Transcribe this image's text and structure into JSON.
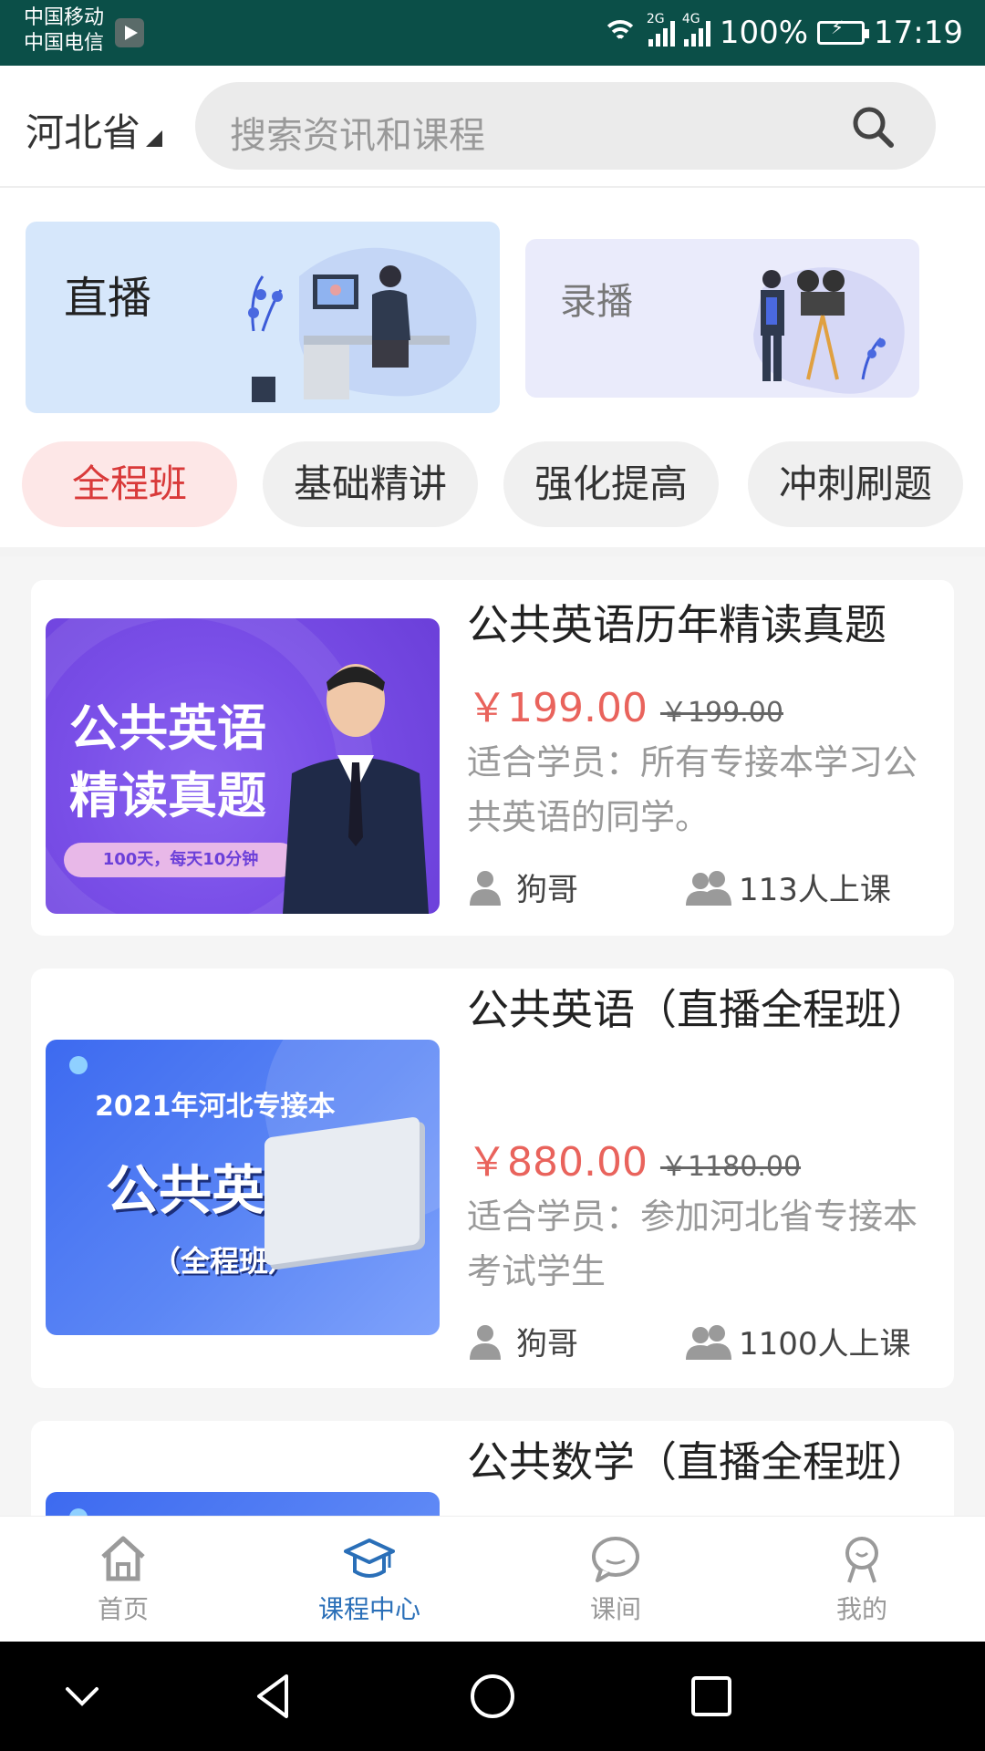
{
  "status_bar": {
    "carrier1": "中国移动",
    "carrier2": "中国电信",
    "net1": "2G",
    "net2": "4G",
    "battery": "100%",
    "time": "17:19"
  },
  "header": {
    "province": "河北省",
    "search_placeholder": "搜索资讯和课程"
  },
  "banners": {
    "live": "直播",
    "recorded": "录播"
  },
  "categories": [
    {
      "label": "全程班",
      "active": true
    },
    {
      "label": "基础精讲",
      "active": false
    },
    {
      "label": "强化提高",
      "active": false
    },
    {
      "label": "冲刺刷题",
      "active": false
    }
  ],
  "courses": [
    {
      "title": "公共英语历年精读真题",
      "price": "￥199.00",
      "old_price": "￥199.00",
      "desc": "适合学员：所有专接本学习公共英语的同学。",
      "teacher": "狗哥",
      "students": "113人上课",
      "thumb_line1": "公共英语",
      "thumb_line2": "精读真题",
      "thumb_badge": "100天，每天10分钟"
    },
    {
      "title": "公共英语（直播全程班）",
      "price": "￥880.00",
      "old_price": "￥1180.00",
      "desc": "适合学员：参加河北省专接本考试学生",
      "teacher": "狗哥",
      "students": "1100人上课",
      "thumb_line1": "2021年河北专接本",
      "thumb_line2": "公共英语",
      "thumb_line3": "（全程班）"
    },
    {
      "title": "公共数学（直播全程班）"
    }
  ],
  "bottom_nav": [
    {
      "label": "首页",
      "icon": "home-icon",
      "active": false
    },
    {
      "label": "课程中心",
      "icon": "graduation-cap-icon",
      "active": true
    },
    {
      "label": "课间",
      "icon": "chat-bubble-icon",
      "active": false
    },
    {
      "label": "我的",
      "icon": "user-icon",
      "active": false
    }
  ],
  "colors": {
    "status_bar": "#0b4f48",
    "accent_red": "#e9635c",
    "active_pill_text": "#d93a3a",
    "nav_active": "#2a6fb8"
  }
}
